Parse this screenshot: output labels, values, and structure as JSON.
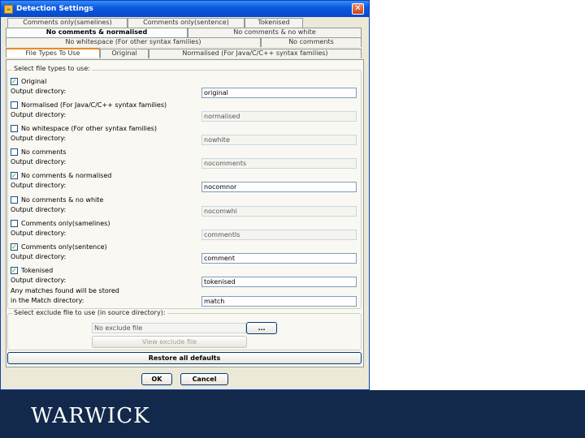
{
  "window": {
    "title": "Detection Settings",
    "close_glyph": "✕",
    "app_icon": "app-icon"
  },
  "tabs": {
    "row1": [
      "Comments only(samelines)",
      "Comments only(sentence)",
      "Tokenised"
    ],
    "row2": [
      "No comments & normalised",
      "No comments & no white"
    ],
    "row3": [
      "No whitespace (For other syntax families)",
      "No comments"
    ],
    "row4": [
      "File Types To Use",
      "Original",
      "Normalised (For Java/C/C++ syntax families)"
    ]
  },
  "file_types": {
    "legend": "Select file types to use:",
    "output_label": "Output directory:",
    "items": [
      {
        "label": "Original",
        "checked": true,
        "dir": "original"
      },
      {
        "label": "Normalised (For Java/C/C++ syntax families)",
        "checked": false,
        "dir": "normalised"
      },
      {
        "label": "No whitespace (For other syntax families)",
        "checked": false,
        "dir": "nowhite"
      },
      {
        "label": "No comments",
        "checked": false,
        "dir": "nocomments"
      },
      {
        "label": "No comments & normalised",
        "checked": true,
        "dir": "nocomnor"
      },
      {
        "label": "No comments & no white",
        "checked": false,
        "dir": "nocomwhi"
      },
      {
        "label": "Comments only(samelines)",
        "checked": false,
        "dir": "commentls"
      },
      {
        "label": "Comments only(sentence)",
        "checked": true,
        "dir": "comment"
      },
      {
        "label": "Tokenised",
        "checked": true,
        "dir": "tokenised"
      }
    ],
    "matches_line1": "Any matches found will be stored",
    "matches_line2": "in the Match directory:",
    "match_dir": "match"
  },
  "exclude": {
    "legend": "Select exclude file to use (in source directory):",
    "field_value": "No exclude file",
    "browse_label": "...",
    "view_label": "View exclude file"
  },
  "buttons": {
    "restore": "Restore all defaults",
    "ok": "OK",
    "cancel": "Cancel"
  },
  "branding": {
    "logo_text": "WARWICK"
  },
  "colors": {
    "footer": "#13294B",
    "titlebar": "#0A5AE0",
    "check": "#21A121"
  }
}
